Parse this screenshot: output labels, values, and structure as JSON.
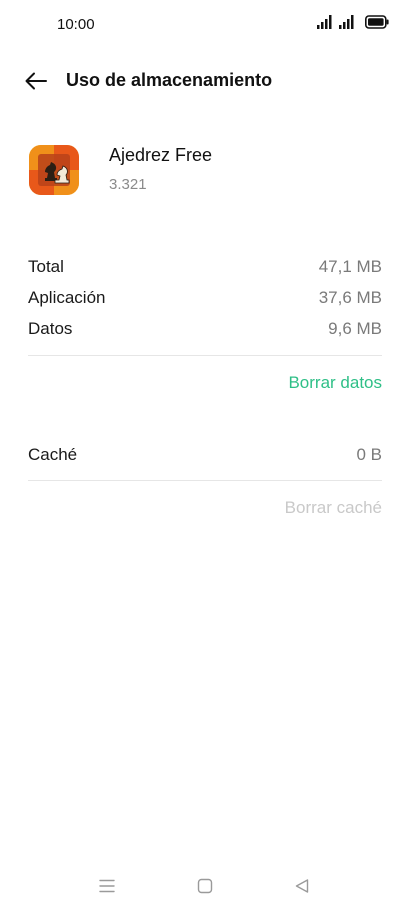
{
  "status_bar": {
    "time": "10:00",
    "icons": [
      "signal-icon",
      "signal-icon",
      "battery-icon"
    ]
  },
  "header": {
    "title": "Uso de almacenamiento",
    "back_icon": "back-arrow-icon"
  },
  "app": {
    "name": "Ajedrez Free",
    "version": "3.321",
    "icon": "chess-app-icon"
  },
  "storage": {
    "rows": [
      {
        "label": "Total",
        "value": "47,1 MB"
      },
      {
        "label": "Aplicación",
        "value": "37,6 MB"
      },
      {
        "label": "Datos",
        "value": "9,6 MB"
      }
    ],
    "clear_data_label": "Borrar datos"
  },
  "cache": {
    "label": "Caché",
    "value": "0 B",
    "clear_cache_label": "Borrar caché",
    "clear_cache_enabled": false
  },
  "nav_bar": {
    "items": [
      "menu-icon",
      "home-icon",
      "back-icon"
    ]
  },
  "colors": {
    "accent": "#2fbf87",
    "disabled": "#c9c9c9",
    "secondary_text": "#7a7a7a"
  }
}
